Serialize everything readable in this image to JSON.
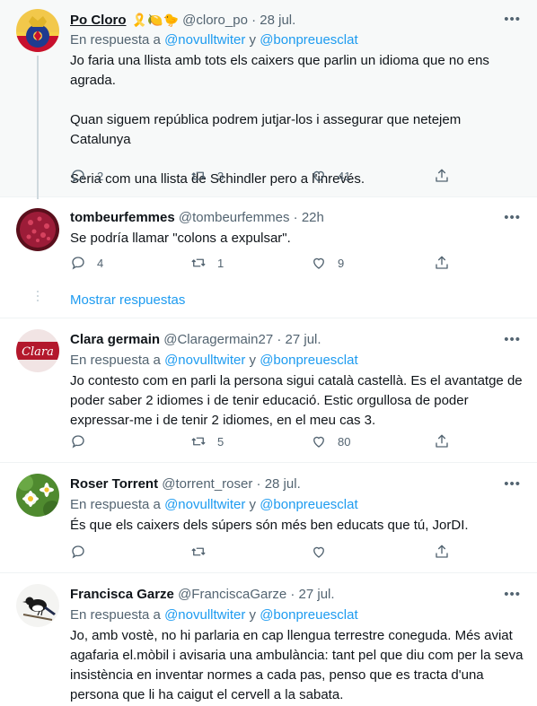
{
  "tweets": [
    {
      "name": "Po Cloro",
      "emojis": "🎗️🍋🐤",
      "handle": "@cloro_po",
      "time": "28 jul.",
      "reply_prefix": "En respuesta a",
      "reply_user1": "@novulltwiter",
      "reply_join": "y",
      "reply_user2": "@bonpreuesclat",
      "paragraphs": [
        "Jo faria una llista amb tots els caixers que parlin un idioma que no ens agrada.",
        "Quan siguem república podrem jutjar-los i assegurar que netejem Catalunya",
        "Seria com una llista de Schindler pero a l'inrevés."
      ],
      "replies": "2",
      "retweets": "3",
      "likes": "41"
    },
    {
      "name": "tombeurfemmes",
      "handle": "@tombeurfemmes",
      "time": "22h",
      "text": "Se podría llamar \"colons a expulsar\".",
      "replies": "4",
      "retweets": "1",
      "likes": "9",
      "show_replies": "Mostrar respuestas"
    },
    {
      "name": "Clara germain",
      "handle": "@Claragermain27",
      "time": "27 jul.",
      "reply_prefix": "En respuesta a",
      "reply_user1": "@novulltwiter",
      "reply_join": "y",
      "reply_user2": "@bonpreuesclat",
      "text": "Jo contesto com en parli la persona sigui català castellà. Es el avantatge de poder saber 2 idiomes i de tenir educació. Estic orgullosa de poder expressar-me i de tenir 2 idiomes, en el meu cas 3.",
      "replies": "",
      "retweets": "5",
      "likes": "80"
    },
    {
      "name": "Roser Torrent",
      "handle": "@torrent_roser",
      "time": "28 jul.",
      "reply_prefix": "En respuesta a",
      "reply_user1": "@novulltwiter",
      "reply_join": "y",
      "reply_user2": "@bonpreuesclat",
      "text": "És que els caixers dels súpers són més ben educats que tú, JorDI.",
      "replies": "",
      "retweets": "",
      "likes": ""
    },
    {
      "name": "Francisca Garze",
      "handle": "@FranciscaGarze",
      "time": "27 jul.",
      "reply_prefix": "En respuesta a",
      "reply_user1": "@novulltwiter",
      "reply_join": "y",
      "reply_user2": "@bonpreuesclat",
      "text": "Jo, amb vostè, no hi parlaria en cap llengua terrestre coneguda. Més aviat agafaria el.mòbil i avisaria una ambulància: tant pel que diu com per la seva insistència en inventar normes a cada pas, penso que es tracta d'una persona que li ha caigut el cervell a la sabata."
    }
  ],
  "avatar_images": {
    "clara_logo_text": "Clara"
  },
  "colors": {
    "link": "#1d9bf0",
    "muted": "#536471",
    "text": "#0f1419",
    "highlight_bg": "#f7f9f9",
    "border": "#eff3f4"
  }
}
